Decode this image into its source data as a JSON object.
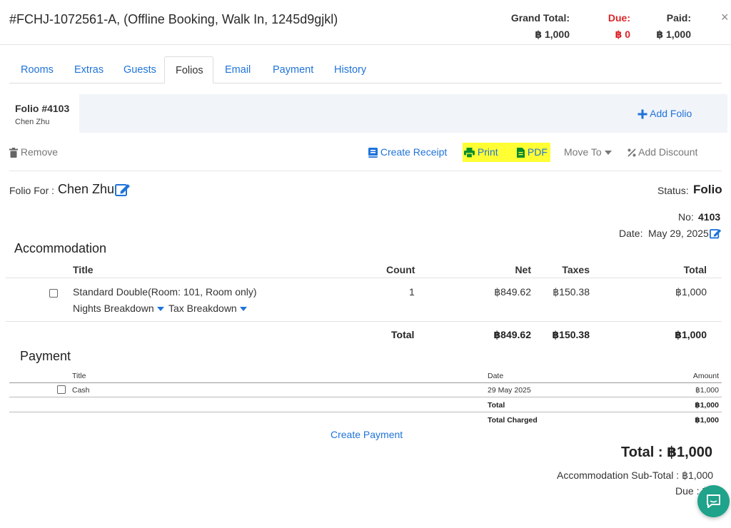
{
  "header": {
    "title": "#FCHJ-1072561-A, (Offline Booking, Walk In, 1245d9gjkl)",
    "grand_total_label": "Grand Total:",
    "grand_total_value": "฿ 1,000",
    "due_label": "Due:",
    "due_value": "฿ 0",
    "paid_label": "Paid:",
    "paid_value": "฿ 1,000",
    "close_icon": "close-icon",
    "close_glyph": "×",
    "colors": {
      "due": "#d9262a",
      "link": "#1f73d9",
      "highlight": "#ffff33"
    }
  },
  "tabs": [
    {
      "label": "Rooms",
      "active": false
    },
    {
      "label": "Extras",
      "active": false
    },
    {
      "label": "Guests",
      "active": false
    },
    {
      "label": "Folios",
      "active": true
    },
    {
      "label": "Email",
      "active": false
    },
    {
      "label": "Payment",
      "active": false
    },
    {
      "label": "History",
      "active": false
    }
  ],
  "folio_tab": {
    "number": "Folio #4103",
    "guest": "Chen Zhu"
  },
  "add_folio_label": "Add Folio",
  "actions": {
    "remove": "Remove",
    "create_receipt": "Create Receipt",
    "print": "Print",
    "pdf": "PDF",
    "move_to": "Move To",
    "add_discount": "Add Discount"
  },
  "folio": {
    "for_label": "Folio For :",
    "for_name": "Chen Zhu",
    "status_label": "Status:",
    "status_value": "Folio",
    "no_label": "No:",
    "no_value": "4103",
    "date_label": "Date:",
    "date_value": "May 29, 2025"
  },
  "accommodation": {
    "section_title": "Accommodation",
    "columns": {
      "title": "Title",
      "count": "Count",
      "net": "Net",
      "taxes": "Taxes",
      "total": "Total"
    },
    "rows": [
      {
        "title": "Standard Double(Room: 101, Room only)",
        "count": "1",
        "net": "฿849.62",
        "taxes": "฿150.38",
        "total": "฿1,000",
        "nights_breakdown": "Nights Breakdown",
        "tax_breakdown": "Tax Breakdown"
      }
    ],
    "totals": {
      "label": "Total",
      "net": "฿849.62",
      "taxes": "฿150.38",
      "total": "฿1,000"
    }
  },
  "payment": {
    "section_title": "Payment",
    "columns": {
      "title": "Title",
      "date": "Date",
      "amount": "Amount"
    },
    "rows": [
      {
        "title": "Cash",
        "date": "29 May 2025",
        "amount": "฿1,000"
      }
    ],
    "total_label": "Total",
    "total_value": "฿1,000",
    "total_charged_label": "Total Charged",
    "total_charged_value": "฿1,000",
    "create_payment": "Create Payment"
  },
  "summary": {
    "total_line": "Total : ฿1,000",
    "accommodation_subtotal": "Accommodation Sub-Total : ฿1,000",
    "due_line": "Due : ฿"
  },
  "chat": {
    "icon": "chat-bubble-icon"
  }
}
